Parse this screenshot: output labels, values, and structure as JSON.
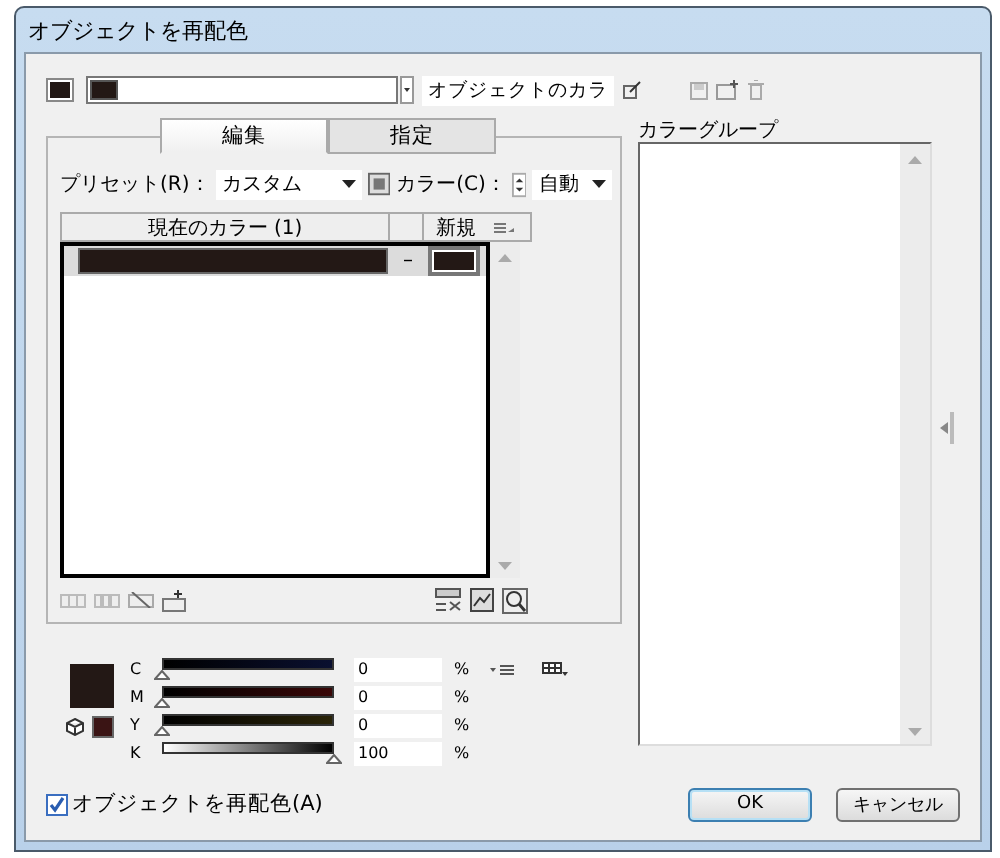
{
  "window": {
    "title": "オブジェクトを再配色"
  },
  "top": {
    "object_color": "オブジェクトのカラ"
  },
  "tabs": [
    {
      "label": "編集",
      "selected": true
    },
    {
      "label": "指定",
      "selected": false
    }
  ],
  "preset": {
    "label": "プリセット(R)：",
    "value": "カスタム",
    "colors_label": "カラー(C)：",
    "colors_value": "自動"
  },
  "table": {
    "columns": [
      "現在のカラー (1)",
      "新規"
    ],
    "rows": [
      {
        "arrow": "–",
        "selected": true
      }
    ]
  },
  "channels": [
    {
      "name": "C",
      "level": 0,
      "value": "0",
      "unit": "%"
    },
    {
      "name": "M",
      "level": 0,
      "value": "0",
      "unit": "%"
    },
    {
      "name": "Y",
      "level": 0,
      "value": "0",
      "unit": "%"
    },
    {
      "name": "K",
      "level": 1,
      "value": "100",
      "unit": "%"
    }
  ],
  "recolor_checkbox": {
    "label": "オブジェクトを再配色(A)",
    "checked": true
  },
  "color_groups": {
    "label": "カラーグループ"
  },
  "buttons": [
    "OK",
    "キャンセル"
  ]
}
